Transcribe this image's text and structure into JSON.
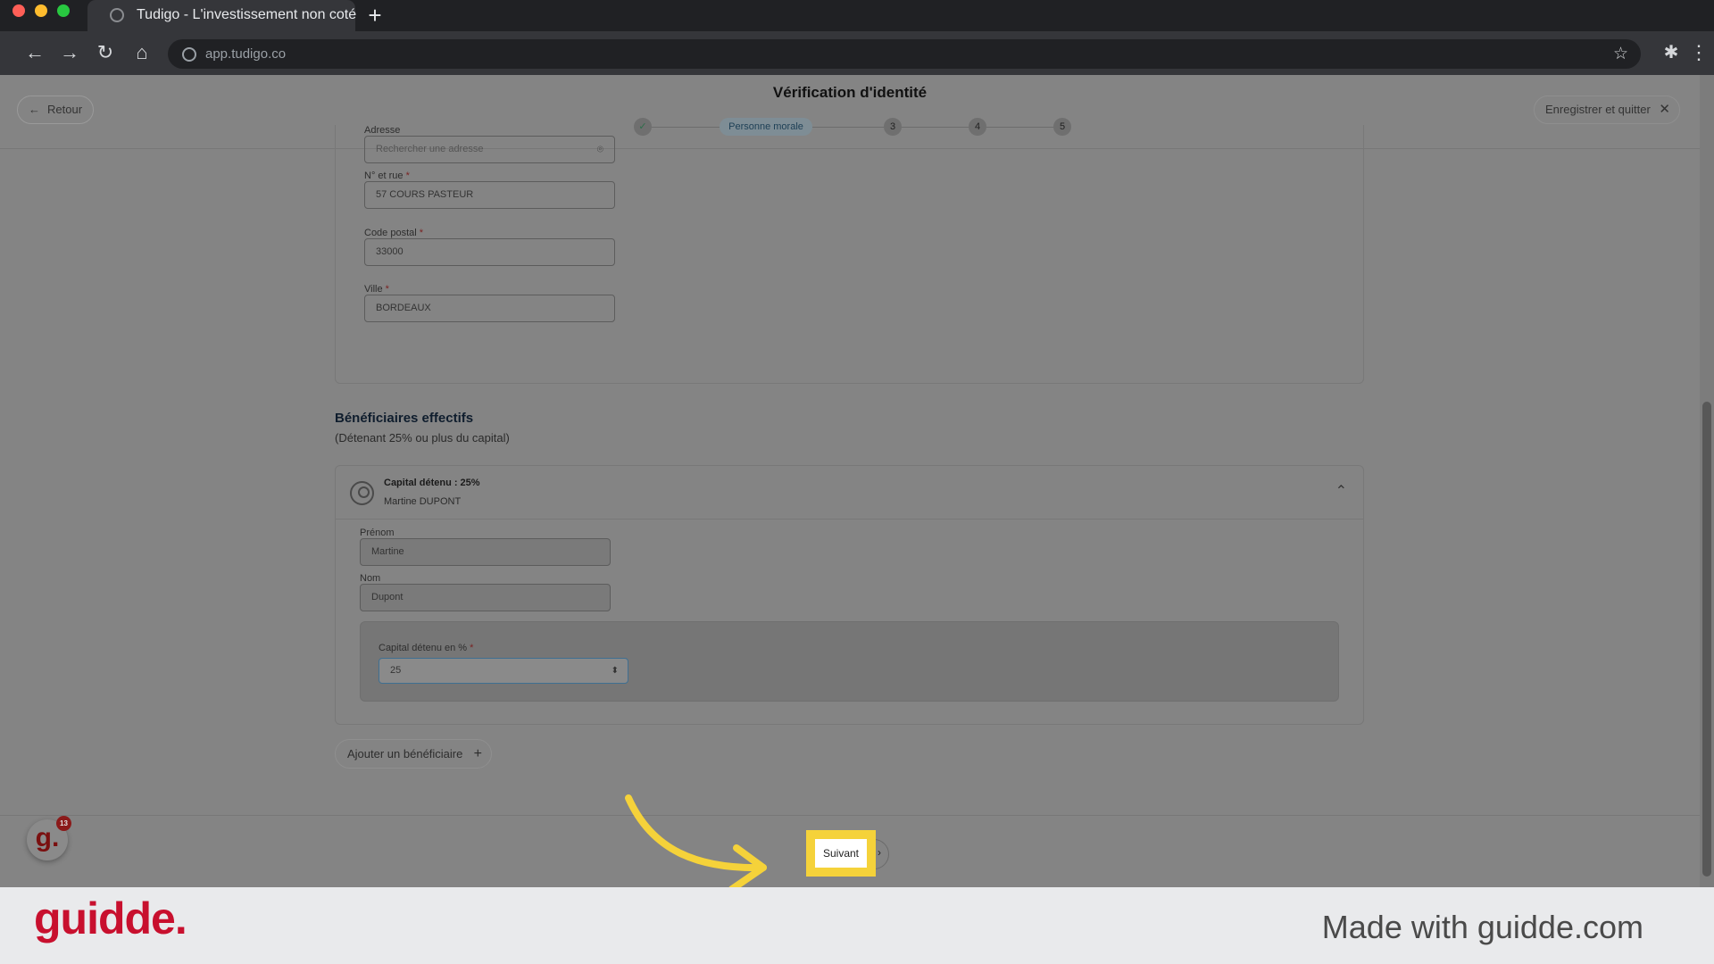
{
  "browser": {
    "tab_title": "Tudigo - L'investissement non coté",
    "new_tab": "+",
    "url": "app.tudigo.co",
    "icons": [
      "back-arrow-icon",
      "forward-arrow-icon",
      "reload-icon",
      "home-icon",
      "globe-icon",
      "star-icon",
      "puzzle-icon",
      "kebab-menu-icon"
    ]
  },
  "header": {
    "back_label": "Retour",
    "title": "Vérification d'identité",
    "save_quit_label": "Enregistrer et quitter",
    "steps": {
      "done": "✓",
      "active": "Personne morale",
      "s3": "3",
      "s4": "4",
      "s5": "5"
    }
  },
  "address": {
    "address_label": "Adresse",
    "address_placeholder": "Rechercher une adresse",
    "street_label": "N° et rue",
    "street_value": "57 COURS PASTEUR",
    "zip_label": "Code postal",
    "zip_value": "33000",
    "city_label": "Ville",
    "city_value": "BORDEAUX",
    "required_mark": "*"
  },
  "beneficiaries": {
    "title": "Bénéficiaires effectifs",
    "subtitle": "(Détenant 25% ou plus du capital)",
    "card": {
      "capital_summary": "Capital détenu : 25%",
      "name_summary": "Martine DUPONT",
      "firstname_label": "Prénom",
      "firstname_value": "Martine",
      "lastname_label": "Nom",
      "lastname_value": "Dupont",
      "capital_label": "Capital détenu en %",
      "capital_value": "25"
    },
    "add_label": "Ajouter un bénéficiaire"
  },
  "footer": {
    "next_label": "Suivant",
    "badge_letter": "g.",
    "badge_count": "13"
  },
  "guidde": {
    "logo": "guidde.",
    "made_with": "Made with guidde.com"
  },
  "colors": {
    "highlight": "#f5d23a",
    "brand_red": "#c8102e"
  }
}
